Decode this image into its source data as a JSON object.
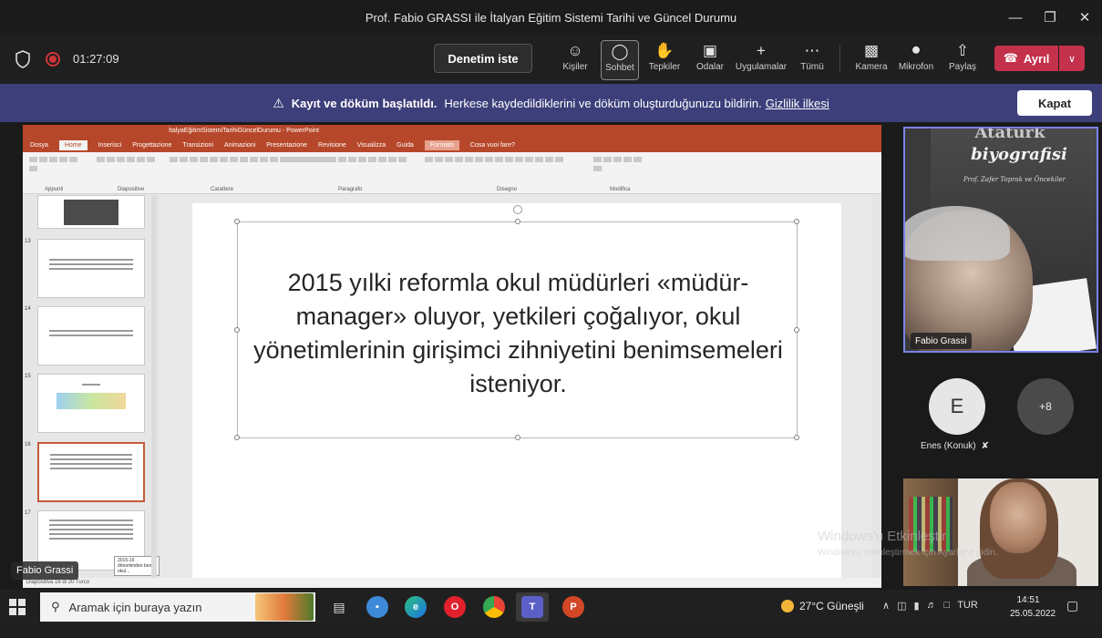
{
  "window": {
    "title": "Prof. Fabio GRASSI ile İtalyan Eğitim Sistemi Tarihi ve Güncel Durumu"
  },
  "toolbar": {
    "timer": "01:27:09",
    "ask_control": "Denetim iste",
    "items": [
      {
        "label": "Kişiler",
        "icon": "people-icon"
      },
      {
        "label": "Sohbet",
        "icon": "chat-icon"
      },
      {
        "label": "Tepkiler",
        "icon": "reactions-icon"
      },
      {
        "label": "Odalar",
        "icon": "rooms-icon"
      },
      {
        "label": "Uygulamalar",
        "icon": "apps-icon"
      },
      {
        "label": "Tümü",
        "icon": "more-icon"
      },
      {
        "label": "Kamera",
        "icon": "camera-icon"
      },
      {
        "label": "Mikrofon",
        "icon": "mic-icon"
      },
      {
        "label": "Paylaş",
        "icon": "share-icon"
      }
    ],
    "leave": "Ayrıl"
  },
  "banner": {
    "bold": "Kayıt ve döküm başlatıldı.",
    "text": "Herkese kaydedildiklerini ve döküm oluşturduğunuzu bildirin.",
    "link": "Gizlilik ilkesi",
    "close": "Kapat"
  },
  "ppt": {
    "titlebar": "İtalyaEğitimSistemiTarihiGüncelDurumu - PowerPoint",
    "tabs": [
      "Dosya",
      "Home",
      "Inserisci",
      "Progettazione",
      "Transizioni",
      "Animazioni",
      "Presentazione",
      "Revisione",
      "Visualizza",
      "Guida",
      "Formato",
      "Cosa vuoi fare?"
    ],
    "ribbon_groups": [
      "Appunti",
      "Diapositive",
      "Carattere",
      "Paragrafo",
      "Disegno",
      "Modifica"
    ],
    "slide_numbers": [
      "13",
      "14",
      "15",
      "16",
      "17"
    ],
    "slide_text": "2015 yılki reformla okul müdürleri «müdür-manager» oluyor, yetkileri çoğalıyor, okul yönetimlerinin girişimci zihniyetini benimsemeleri isteniyor.",
    "status": "Diapositiva 16 di 20    Turco",
    "tooltip": "2015-16 döneminden ben okul..."
  },
  "participants": {
    "presenter_tag": "Fabio Grassi",
    "fabio": {
      "name": "Fabio Grassi",
      "book_top": "Atatürk",
      "book_title": "biyografisi",
      "book_sub": "Prof. Zafer Toprak ve Öncekiler"
    },
    "avatar_e": "E",
    "enes": "Enes (Konuk)",
    "more": "+8"
  },
  "watermark": {
    "line1": "Windows'u Etkinleştir",
    "line2": "Windows'u etkinleştirmek için Ayarlar'a gidin."
  },
  "taskbar": {
    "search_placeholder": "Aramak için buraya yazın",
    "weather": "27°C  Güneşli",
    "lang": "TUR",
    "time": "14:51",
    "date": "25.05.2022"
  }
}
